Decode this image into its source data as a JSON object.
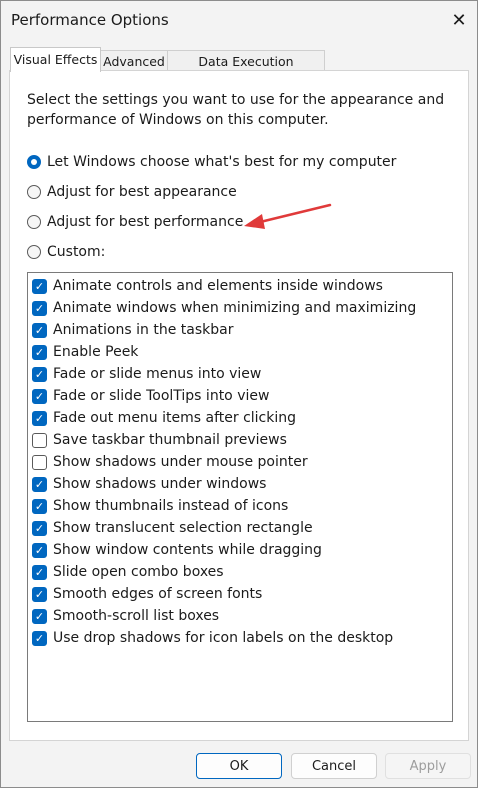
{
  "window": {
    "title": "Performance Options",
    "close_glyph": "✕"
  },
  "tabs": [
    {
      "label": "Visual Effects",
      "active": true
    },
    {
      "label": "Advanced",
      "active": false
    },
    {
      "label": "Data Execution Prevention",
      "active": false
    }
  ],
  "visual_effects": {
    "description": "Select the settings you want to use for the appearance and performance of Windows on this computer.",
    "options": [
      {
        "label": "Let Windows choose what's best for my computer",
        "selected": true
      },
      {
        "label": "Adjust for best appearance",
        "selected": false
      },
      {
        "label": "Adjust for best performance",
        "selected": false
      },
      {
        "label": "Custom:",
        "selected": false
      }
    ],
    "effects": [
      {
        "label": "Animate controls and elements inside windows",
        "checked": true
      },
      {
        "label": "Animate windows when minimizing and maximizing",
        "checked": true
      },
      {
        "label": "Animations in the taskbar",
        "checked": true
      },
      {
        "label": "Enable Peek",
        "checked": true
      },
      {
        "label": "Fade or slide menus into view",
        "checked": true
      },
      {
        "label": "Fade or slide ToolTips into view",
        "checked": true
      },
      {
        "label": "Fade out menu items after clicking",
        "checked": true
      },
      {
        "label": "Save taskbar thumbnail previews",
        "checked": false
      },
      {
        "label": "Show shadows under mouse pointer",
        "checked": false
      },
      {
        "label": "Show shadows under windows",
        "checked": true
      },
      {
        "label": "Show thumbnails instead of icons",
        "checked": true
      },
      {
        "label": "Show translucent selection rectangle",
        "checked": true
      },
      {
        "label": "Show window contents while dragging",
        "checked": true
      },
      {
        "label": "Slide open combo boxes",
        "checked": true
      },
      {
        "label": "Smooth edges of screen fonts",
        "checked": true
      },
      {
        "label": "Smooth-scroll list boxes",
        "checked": true
      },
      {
        "label": "Use drop shadows for icon labels on the desktop",
        "checked": true
      }
    ]
  },
  "buttons": {
    "ok": "OK",
    "cancel": "Cancel",
    "apply": "Apply"
  },
  "colors": {
    "accent": "#0067c0",
    "annotation_arrow": "#e03a3a"
  }
}
